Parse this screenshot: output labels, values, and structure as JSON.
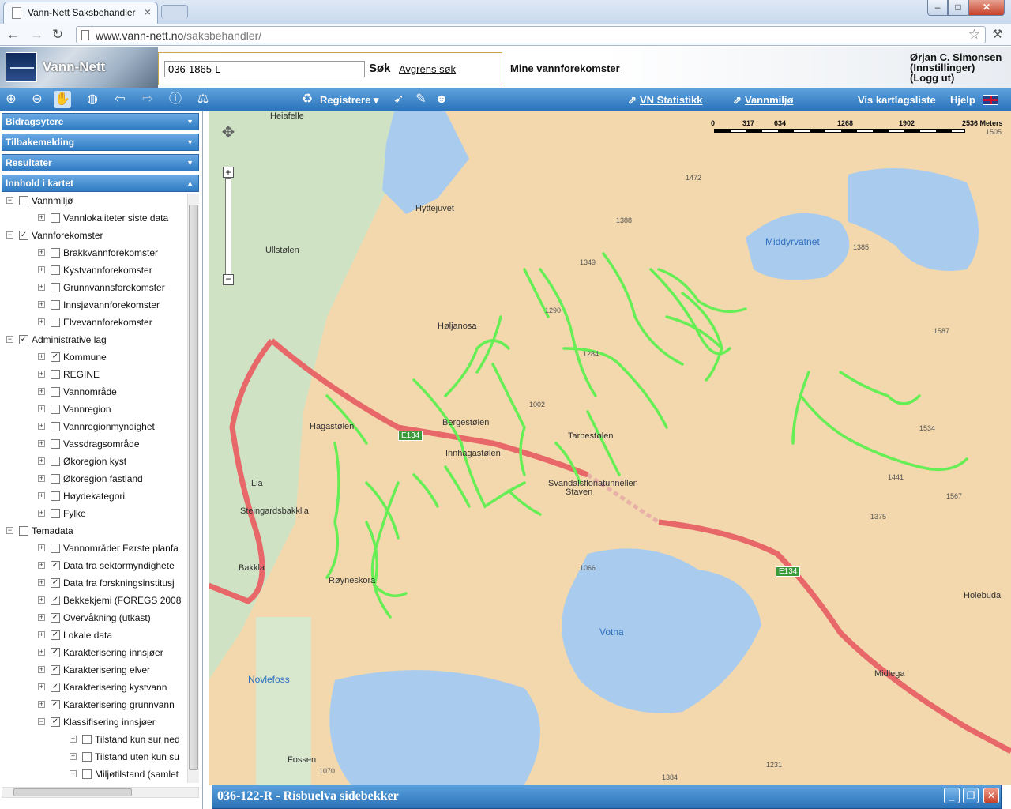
{
  "browser": {
    "tab_title": "Vann-Nett Saksbehandler",
    "tab_close": "×",
    "window_buttons": {
      "minimize": "–",
      "maximize": "□",
      "close": "✕"
    },
    "url_host": "www.vann-nett.no",
    "url_path": "/saksbehandler/"
  },
  "header": {
    "logo_text": "Vann-Nett",
    "search_value": "036-1865-L",
    "search_button": "Søk",
    "refine_link": "Avgrens søk",
    "mine_link": "Mine vannforekomster",
    "user_name": "Ørjan C. Simonsen",
    "user_settings": "(Innstillinger)",
    "user_logout": "(Logg ut)"
  },
  "maptoolbar": {
    "register": "Registrere",
    "vn_statistikk": "VN Statistikk",
    "vannmiljo": "Vannmiljø",
    "vis_kartlagsliste": "Vis kartlagsliste",
    "hjelp": "Hjelp"
  },
  "sidebar": {
    "accordions": [
      "Bidragsytere",
      "Tilbakemelding",
      "Resultater",
      "Innhold i kartet"
    ],
    "tree": [
      {
        "label": "Vannmiljø",
        "level": 0,
        "checked": false,
        "expand": "−"
      },
      {
        "label": "Vannlokaliteter siste data",
        "level": 1,
        "checked": false,
        "expand": "+"
      },
      {
        "label": "Vannforekomster",
        "level": 0,
        "checked": true,
        "expand": "−"
      },
      {
        "label": "Brakkvannforekomster",
        "level": 1,
        "checked": false,
        "expand": "+"
      },
      {
        "label": "Kystvannforekomster",
        "level": 1,
        "checked": false,
        "expand": "+"
      },
      {
        "label": "Grunnvannsforekomster",
        "level": 1,
        "checked": false,
        "expand": "+"
      },
      {
        "label": "Innsjøvannforekomster",
        "level": 1,
        "checked": false,
        "expand": "+"
      },
      {
        "label": "Elvevannforekomster",
        "level": 1,
        "checked": false,
        "expand": "+"
      },
      {
        "label": "Administrative lag",
        "level": 0,
        "checked": true,
        "expand": "−"
      },
      {
        "label": "Kommune",
        "level": 1,
        "checked": true,
        "expand": "+"
      },
      {
        "label": "REGINE",
        "level": 1,
        "checked": false,
        "expand": "+"
      },
      {
        "label": "Vannområde",
        "level": 1,
        "checked": false,
        "expand": "+"
      },
      {
        "label": "Vannregion",
        "level": 1,
        "checked": false,
        "expand": "+"
      },
      {
        "label": "Vannregionmyndighet",
        "level": 1,
        "checked": false,
        "expand": "+"
      },
      {
        "label": "Vassdragsområde",
        "level": 1,
        "checked": false,
        "expand": "+"
      },
      {
        "label": "Økoregion kyst",
        "level": 1,
        "checked": false,
        "expand": "+"
      },
      {
        "label": "Økoregion fastland",
        "level": 1,
        "checked": false,
        "expand": "+"
      },
      {
        "label": "Høydekategori",
        "level": 1,
        "checked": false,
        "expand": "+"
      },
      {
        "label": "Fylke",
        "level": 1,
        "checked": false,
        "expand": "+"
      },
      {
        "label": "Temadata",
        "level": 0,
        "checked": false,
        "expand": "−"
      },
      {
        "label": "Vannområder Første planfa",
        "level": 1,
        "checked": false,
        "expand": "+"
      },
      {
        "label": "Data fra sektormyndighete",
        "level": 1,
        "checked": true,
        "expand": "+"
      },
      {
        "label": "Data fra forskningsinstitusj",
        "level": 1,
        "checked": true,
        "expand": "+"
      },
      {
        "label": "Bekkekjemi (FOREGS 2008",
        "level": 1,
        "checked": true,
        "expand": "+"
      },
      {
        "label": "Overvåkning (utkast)",
        "level": 1,
        "checked": true,
        "expand": "+"
      },
      {
        "label": "Lokale data",
        "level": 1,
        "checked": true,
        "expand": "+"
      },
      {
        "label": "Karakterisering innsjøer",
        "level": 1,
        "checked": true,
        "expand": "+"
      },
      {
        "label": "Karakterisering elver",
        "level": 1,
        "checked": true,
        "expand": "+"
      },
      {
        "label": "Karakterisering kystvann",
        "level": 1,
        "checked": true,
        "expand": "+"
      },
      {
        "label": "Karakterisering grunnvann",
        "level": 1,
        "checked": true,
        "expand": "+"
      },
      {
        "label": "Klassifisering innsjøer",
        "level": 1,
        "checked": true,
        "expand": "−"
      },
      {
        "label": "Tilstand kun sur ned",
        "level": 2,
        "checked": false,
        "expand": "+"
      },
      {
        "label": "Tilstand uten kun su",
        "level": 2,
        "checked": false,
        "expand": "+"
      },
      {
        "label": "Miljøtilstand (samlet",
        "level": 2,
        "checked": false,
        "expand": "+"
      }
    ]
  },
  "map": {
    "scale_labels": [
      "0",
      "317",
      "634",
      "1268",
      "1902",
      "2536 Meters"
    ],
    "places": [
      "Heiafelle",
      "Hyttejuvet",
      "Ullstølen",
      "Høljanosa",
      "Middyrvatnet",
      "Hagastølen",
      "Bergestølen",
      "Innhagastølen",
      "Tarbestølen",
      "Svandalsflonatunnellen",
      "Staven",
      "Lia",
      "Steingardsbakklia",
      "Bakkla",
      "Røyneskora",
      "Votna",
      "Novlefoss",
      "Fossen",
      "Midlega",
      "Holebuda"
    ],
    "peaks": [
      "1472",
      "1388",
      "1349",
      "1290",
      "1284",
      "1002",
      "1385",
      "1587",
      "1534",
      "1441",
      "1567",
      "1375",
      "1066",
      "1231",
      "1070",
      "1384",
      "1505"
    ],
    "road_shields": [
      "E134",
      "E134"
    ],
    "zoom_in": "+",
    "zoom_out": "−"
  },
  "info_panel": {
    "title": "036-122-R - Risbuelva sidebekker",
    "buttons": {
      "minimize": "_",
      "restore": "❐",
      "close": "✕"
    }
  },
  "colors": {
    "accent": "#2f7bc3",
    "river_highlight": "#66ee55",
    "road": "#e8686a"
  }
}
